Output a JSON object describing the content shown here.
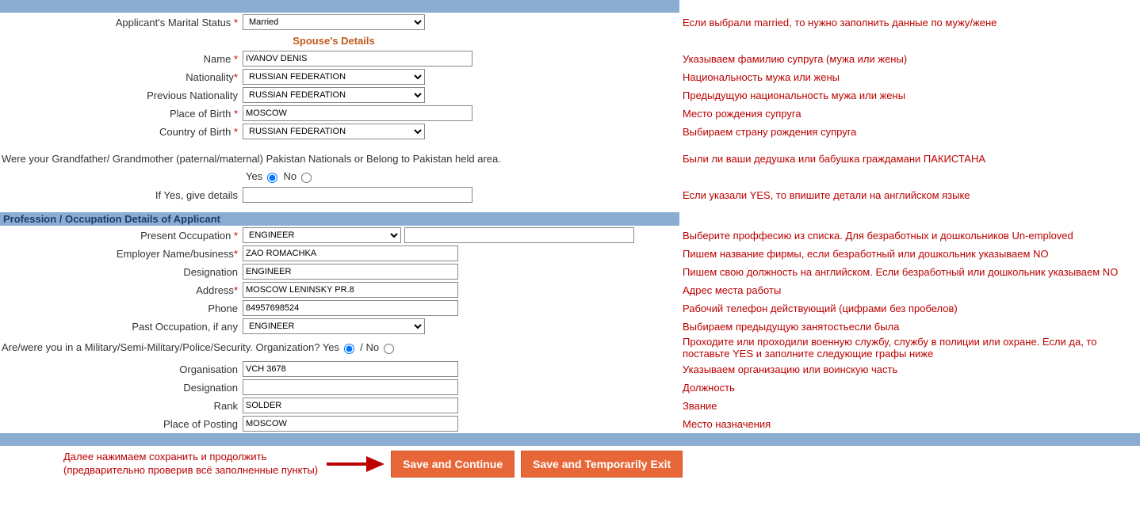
{
  "marital": {
    "label": "Applicant's Marital Status",
    "value": "Married",
    "hint": "Если выбрали married, то нужно заполнить данные по мужу/жене"
  },
  "spouse": {
    "title": "Spouse's Details",
    "name": {
      "label": "Name",
      "value": "IVANOV DENIS",
      "hint": "Указываем фамилию супруга (мужа или жены)"
    },
    "nationality": {
      "label": "Nationality",
      "value": "RUSSIAN FEDERATION",
      "hint": "Национальность мужа или жены"
    },
    "prev_nationality": {
      "label": "Previous Nationality",
      "value": "RUSSIAN FEDERATION",
      "hint": "Предыдущую национальность мужа или жены"
    },
    "place_of_birth": {
      "label": "Place of Birth",
      "value": "MOSCOW",
      "hint": "Место рождения супруга"
    },
    "country_of_birth": {
      "label": "Country of Birth",
      "value": "RUSSIAN FEDERATION",
      "hint": "Выбираем страну рождения супруга"
    }
  },
  "pakistan": {
    "question": "Were your Grandfather/ Grandmother (paternal/maternal) Pakistan Nationals or Belong to Pakistan held area.",
    "yes": "Yes",
    "no": "No",
    "hint": "Были ли ваши дедушка или бабушка граждамани ПАКИСТАНА",
    "details_label": "If Yes, give details",
    "details_hint": "Если указали YES, то впишите детали на английском языке"
  },
  "profession": {
    "header": "Profession / Occupation Details of Applicant",
    "present": {
      "label": "Present Occupation",
      "value": "ENGINEER",
      "hint": "Выберите проффесию из списка. Для безработных и дошкольников Un-emploved"
    },
    "employer": {
      "label": "Employer Name/business",
      "value": "ZAO ROMACHKA",
      "hint": "Пишем название фирмы, если безработный или дошкольник указываем NO"
    },
    "designation": {
      "label": "Designation",
      "value": "ENGINEER",
      "hint": "Пишем свою должность на английском. Если безработный или дошкольник указываем NO"
    },
    "address": {
      "label": "Address",
      "value": "MOSCOW LENINSKY PR.8",
      "hint": "Адрес места работы"
    },
    "phone": {
      "label": "Phone",
      "value": "84957698524",
      "hint": "Рабочий телефон действующий (цифрами без пробелов)"
    },
    "past": {
      "label": "Past Occupation, if any",
      "value": "ENGINEER",
      "hint": "Выбираем предыдущую занятостьесли была"
    }
  },
  "military": {
    "question": "Are/were you in a Military/Semi-Military/Police/Security. Organization? Yes",
    "no_label": "/ No",
    "hint": "Проходите или проходили военную службу, службу в полиции или охране. Если да, то поставьте YES и заполните следующие графы ниже",
    "org": {
      "label": "Organisation",
      "value": "VCH 3678",
      "hint": "Указываем организацию или воинскую часть"
    },
    "desig": {
      "label": "Designation",
      "value": "",
      "hint": "Должность"
    },
    "rank": {
      "label": "Rank",
      "value": "SOLDER",
      "hint": "Звание"
    },
    "posting": {
      "label": "Place of Posting",
      "value": "MOSCOW",
      "hint": "Место назначения"
    }
  },
  "footer": {
    "text1": "Далее нажимаем сохранить и продолжить",
    "text2": "(предварительно проверив всё заполненные пункты)",
    "save_continue": "Save and Continue",
    "save_exit": "Save and Temporarily Exit"
  }
}
